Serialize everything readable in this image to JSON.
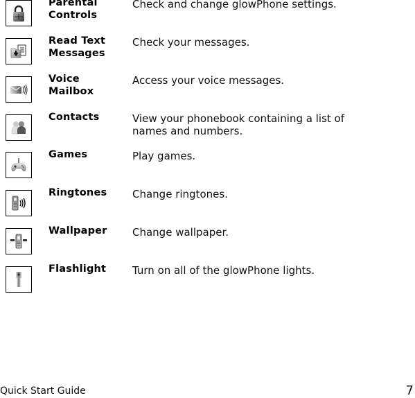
{
  "items": [
    {
      "label": "Parental Controls",
      "label_l1": "Parental",
      "label_l2": "Controls",
      "description": "Check and change glowPhone settings.",
      "icon": "padlock-icon"
    },
    {
      "label": "Read Text Messages",
      "label_l1": "Read Text",
      "label_l2": "Messages",
      "description": "Check your messages.",
      "icon": "inbox-messages-icon"
    },
    {
      "label": "Voice Mailbox",
      "label_l1": "Voice",
      "label_l2": "Mailbox",
      "description": "Access your voice messages.",
      "icon": "voice-envelope-icon"
    },
    {
      "label": "Contacts",
      "label_l1": "Contacts",
      "label_l2": "",
      "description": "View your phonebook containing a list of names and numbers.",
      "desc_l1": "View your phonebook containing a list of",
      "desc_l2": "names and numbers.",
      "icon": "contacts-people-icon"
    },
    {
      "label": "Games",
      "label_l1": "Games",
      "label_l2": "",
      "description": "Play games.",
      "icon": "gamepad-icon"
    },
    {
      "label": "Ringtones",
      "label_l1": "Ringtones",
      "label_l2": "",
      "description": "Change ringtones.",
      "icon": "phone-ringing-icon"
    },
    {
      "label": "Wallpaper",
      "label_l1": "Wallpaper",
      "label_l2": "",
      "description": "Change wallpaper.",
      "icon": "phone-wallpaper-icon"
    },
    {
      "label": "Flashlight",
      "label_l1": "Flashlight",
      "label_l2": "",
      "description": "Turn on all of the glowPhone lights.",
      "icon": "flashlight-icon"
    }
  ],
  "footer": {
    "title": "Quick Start Guide",
    "page_number": "7"
  }
}
